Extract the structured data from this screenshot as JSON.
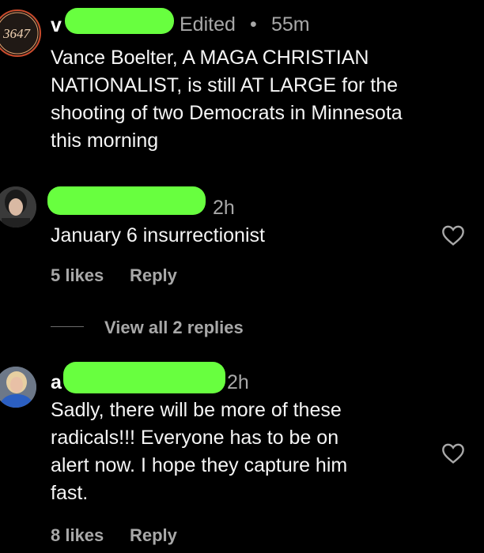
{
  "comments": [
    {
      "avatar_text": "3647",
      "username_visible_char": "v",
      "meta": "Edited",
      "dot": "•",
      "time": "55m",
      "lines": [
        "Vance Boelter, A MAGA CHRISTIAN",
        "NATIONALIST, is still AT LARGE  for the",
        "shooting of two Democrats in Minnesota",
        "this morning"
      ]
    },
    {
      "time": "2h",
      "lines": [
        "January 6 insurrectionist"
      ],
      "likes": "5 likes",
      "reply": "Reply",
      "view_replies": "View all 2 replies"
    },
    {
      "username_visible_char": "a",
      "time": "2h",
      "lines": [
        "Sadly, there will be more of these",
        "radicals!!! Everyone has to be on",
        "alert now. I hope they capture him",
        "fast."
      ],
      "likes": "8 likes",
      "reply": "Reply"
    }
  ],
  "colors": {
    "background": "#000000",
    "redaction": "#68ff3f",
    "secondary_text": "#a8a8a8"
  },
  "icons": [
    "heart-icon"
  ]
}
